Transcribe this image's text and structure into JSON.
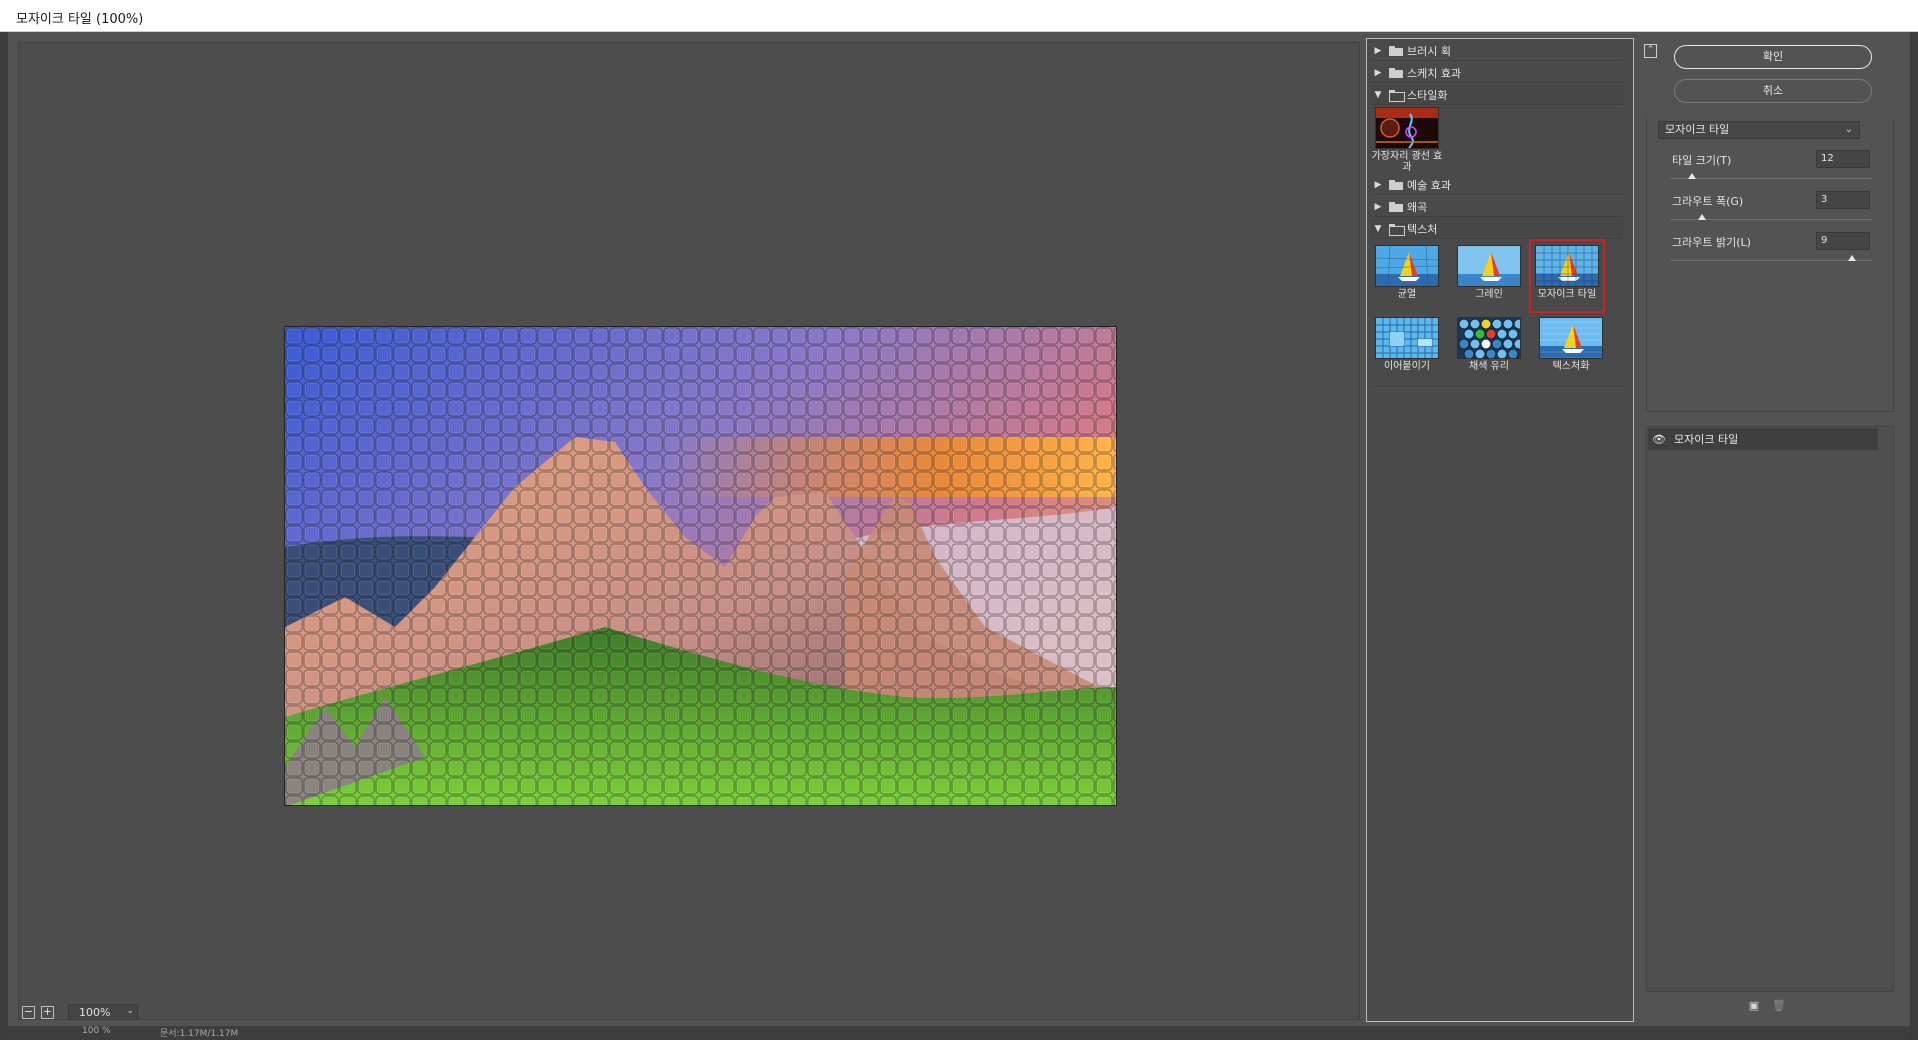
{
  "window": {
    "title": "모자이크 타일 (100%)"
  },
  "preview": {
    "zoom_out_icon": "−",
    "zoom_in_icon": "+",
    "zoom_value": "100%",
    "status_zoom": "100 %",
    "status_doc": "문서:1.17M/1.17M"
  },
  "gallery": {
    "groups": {
      "brush": {
        "label": "브러시 획",
        "open": false
      },
      "sketch": {
        "label": "스케치 효과",
        "open": false
      },
      "stylize": {
        "label": "스타일화",
        "open": true
      },
      "artistic": {
        "label": "예술 효과",
        "open": false
      },
      "distort": {
        "label": "왜곡",
        "open": false
      },
      "texture": {
        "label": "텍스처",
        "open": true
      }
    },
    "stylize_items": [
      {
        "label": "가장자리 광선 효과"
      }
    ],
    "texture_items": [
      {
        "label": "균열"
      },
      {
        "label": "그레인"
      },
      {
        "label": "모자이크 타일",
        "selected": true
      },
      {
        "label": "이어붙이기"
      },
      {
        "label": "채색 유리"
      },
      {
        "label": "텍스처화"
      }
    ]
  },
  "actions": {
    "ok_label": "확인",
    "cancel_label": "취소"
  },
  "settings": {
    "filter": "모자이크 타일",
    "params": [
      {
        "label": "타일 크기(T)",
        "value": "12",
        "fraction": 0.1
      },
      {
        "label": "그라우트 폭(G)",
        "value": "3",
        "fraction": 0.15
      },
      {
        "label": "그라우트 밝기(L)",
        "value": "9",
        "fraction": 0.9
      }
    ]
  },
  "layers": {
    "items": [
      {
        "name": "모자이크 타일",
        "visible": true
      }
    ]
  },
  "colors": {
    "selected_outline": "#d0202a",
    "panel_bg": "#535353"
  }
}
